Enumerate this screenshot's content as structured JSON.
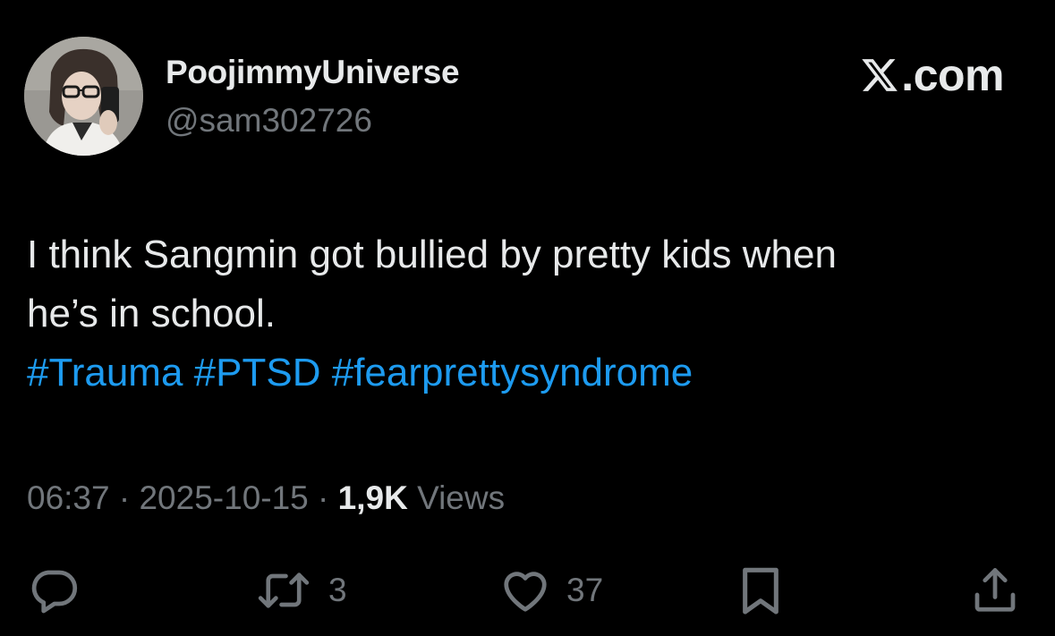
{
  "author": {
    "display_name": "PoojimmyUniverse",
    "handle": "@sam302726"
  },
  "brand": {
    "logo_icon": "x-logo-icon",
    "text": ".com"
  },
  "tweet": {
    "lines": [
      "I think Sangmin got bullied by pretty kids when",
      "he’s in school."
    ],
    "hashtags": [
      "#Trauma",
      "#PTSD",
      "#fearprettysyndrome"
    ]
  },
  "meta": {
    "time": "06:37",
    "separator": "·",
    "date": "2025-10-15",
    "views_count": "1,9K",
    "views_label": "Views"
  },
  "actions": {
    "reply": {
      "icon": "reply-icon",
      "count": ""
    },
    "retweet": {
      "icon": "retweet-icon",
      "count": "3"
    },
    "like": {
      "icon": "heart-icon",
      "count": "37"
    },
    "bookmark": {
      "icon": "bookmark-icon",
      "count": ""
    },
    "share": {
      "icon": "share-icon",
      "count": ""
    }
  },
  "colors": {
    "background": "#000000",
    "text": "#e7e9ea",
    "secondary": "#71767b",
    "link": "#1d9bf0"
  }
}
